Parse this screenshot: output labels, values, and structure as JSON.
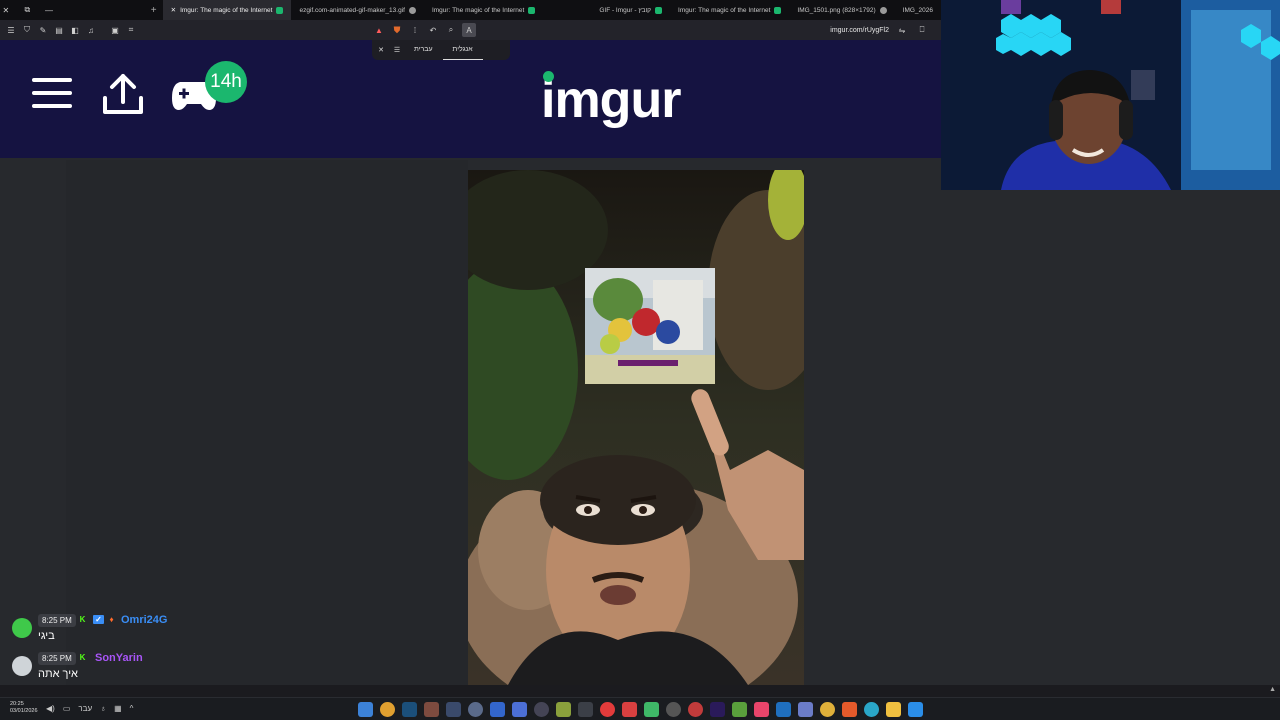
{
  "tabs": [
    {
      "title": "Imgur: The magic of the Internet",
      "active": true
    },
    {
      "title": "ezgif.com-animated-gif-maker_13.gif",
      "active": false
    },
    {
      "title": "Imgur: The magic of the Internet",
      "active": false
    },
    {
      "title": "GIF - Imgur - קובץ",
      "active": false
    },
    {
      "title": "Imgur: The magic of the Internet",
      "active": false
    },
    {
      "title": "IMG_1501.png (828×1792)",
      "active": false
    },
    {
      "title": "IMG_2026",
      "active": false
    }
  ],
  "toolbar": {
    "url": "imgur.com/rUygFl2"
  },
  "translate": {
    "lang_hebrew": "עברית",
    "lang_english": "אנגלית"
  },
  "imgur": {
    "logo": "imgur",
    "badge": "14h"
  },
  "chat": [
    {
      "time": "8:25 PM",
      "user": "Omri24G",
      "user_color": "#3a8ef6",
      "text": "ביגי",
      "avatar_color": "#3fc94a"
    },
    {
      "time": "8:25 PM",
      "user": "SonYarin",
      "user_color": "#a855f7",
      "text": "איך אתה",
      "avatar_color": "#cfd4d8"
    }
  ],
  "taskbar": {
    "time": "20:25",
    "date": "03/01/2026",
    "lang": "עבר"
  },
  "colors": {
    "imgur_header": "#151341",
    "imgur_green": "#1bb76e"
  }
}
